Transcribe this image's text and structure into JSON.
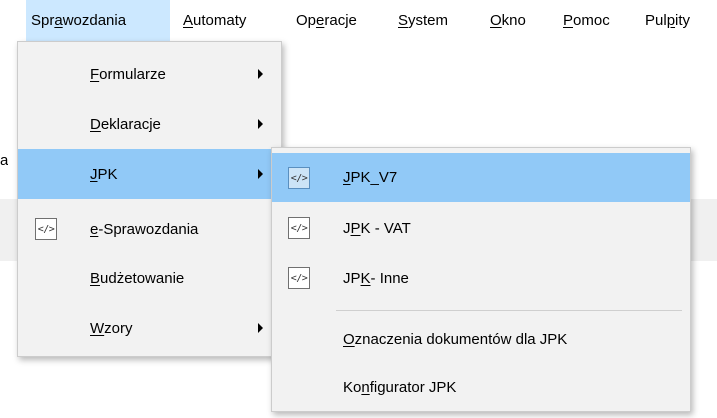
{
  "menubar": {
    "items": [
      {
        "pre": "Spr",
        "key": "a",
        "post": "wozdania"
      },
      {
        "pre": "",
        "key": "A",
        "post": "utomaty"
      },
      {
        "pre": "Op",
        "key": "e",
        "post": "racje"
      },
      {
        "pre": "",
        "key": "S",
        "post": "ystem"
      },
      {
        "pre": "",
        "key": "O",
        "post": "kno"
      },
      {
        "pre": "",
        "key": "P",
        "post": "omoc"
      },
      {
        "pre": "Pul",
        "key": "p",
        "post": "ity"
      }
    ]
  },
  "background": {
    "partial_char": "a"
  },
  "sprawozdania_menu": {
    "items": [
      {
        "pre": "",
        "key": "F",
        "post": "ormularze"
      },
      {
        "pre": "",
        "key": "D",
        "post": "eklaracje"
      },
      {
        "pre": "",
        "key": "J",
        "post": "PK"
      },
      {
        "pre": "",
        "key": "e",
        "post": "-Sprawozdania",
        "icon_text": "</>"
      },
      {
        "pre": "",
        "key": "B",
        "post": "udżetowanie"
      },
      {
        "pre": "",
        "key": "W",
        "post": "zory"
      }
    ]
  },
  "jpk_submenu": {
    "items": [
      {
        "pre": "",
        "key": "J",
        "post": "PK_V7",
        "icon_text": "</>"
      },
      {
        "pre": "J",
        "key": "P",
        "post": "K - VAT",
        "icon_text": "</>"
      },
      {
        "pre": "JP",
        "key": "K",
        "post": " - Inne",
        "icon_text": "</>"
      },
      {
        "pre": "",
        "key": "O",
        "post": "znaczenia dokumentów dla JPK"
      },
      {
        "pre": "Ko",
        "key": "n",
        "post": "figurator JPK"
      }
    ]
  },
  "colors": {
    "menubar_active": "#cce8ff",
    "menu_highlight": "#91c9f7",
    "menu_background": "#f2f2f2"
  },
  "icons": {
    "submenu_arrow": "triangle-right",
    "code_icon": "code-brackets"
  }
}
